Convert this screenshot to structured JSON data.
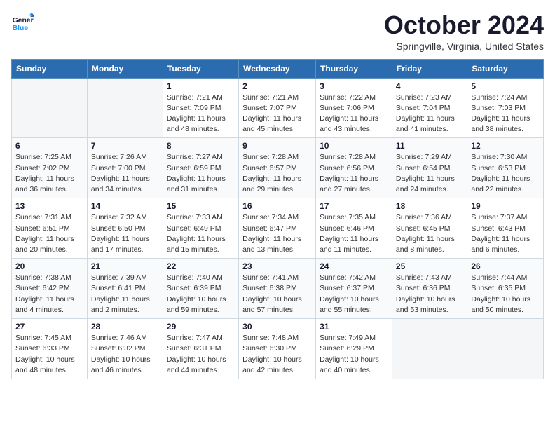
{
  "logo": {
    "text_general": "General",
    "text_blue": "Blue"
  },
  "title": "October 2024",
  "location": "Springville, Virginia, United States",
  "days_of_week": [
    "Sunday",
    "Monday",
    "Tuesday",
    "Wednesday",
    "Thursday",
    "Friday",
    "Saturday"
  ],
  "weeks": [
    [
      {
        "num": "",
        "empty": true
      },
      {
        "num": "",
        "empty": true
      },
      {
        "num": "1",
        "sunrise": "7:21 AM",
        "sunset": "7:09 PM",
        "daylight": "11 hours and 48 minutes."
      },
      {
        "num": "2",
        "sunrise": "7:21 AM",
        "sunset": "7:07 PM",
        "daylight": "11 hours and 45 minutes."
      },
      {
        "num": "3",
        "sunrise": "7:22 AM",
        "sunset": "7:06 PM",
        "daylight": "11 hours and 43 minutes."
      },
      {
        "num": "4",
        "sunrise": "7:23 AM",
        "sunset": "7:04 PM",
        "daylight": "11 hours and 41 minutes."
      },
      {
        "num": "5",
        "sunrise": "7:24 AM",
        "sunset": "7:03 PM",
        "daylight": "11 hours and 38 minutes."
      }
    ],
    [
      {
        "num": "6",
        "sunrise": "7:25 AM",
        "sunset": "7:02 PM",
        "daylight": "11 hours and 36 minutes."
      },
      {
        "num": "7",
        "sunrise": "7:26 AM",
        "sunset": "7:00 PM",
        "daylight": "11 hours and 34 minutes."
      },
      {
        "num": "8",
        "sunrise": "7:27 AM",
        "sunset": "6:59 PM",
        "daylight": "11 hours and 31 minutes."
      },
      {
        "num": "9",
        "sunrise": "7:28 AM",
        "sunset": "6:57 PM",
        "daylight": "11 hours and 29 minutes."
      },
      {
        "num": "10",
        "sunrise": "7:28 AM",
        "sunset": "6:56 PM",
        "daylight": "11 hours and 27 minutes."
      },
      {
        "num": "11",
        "sunrise": "7:29 AM",
        "sunset": "6:54 PM",
        "daylight": "11 hours and 24 minutes."
      },
      {
        "num": "12",
        "sunrise": "7:30 AM",
        "sunset": "6:53 PM",
        "daylight": "11 hours and 22 minutes."
      }
    ],
    [
      {
        "num": "13",
        "sunrise": "7:31 AM",
        "sunset": "6:51 PM",
        "daylight": "11 hours and 20 minutes."
      },
      {
        "num": "14",
        "sunrise": "7:32 AM",
        "sunset": "6:50 PM",
        "daylight": "11 hours and 17 minutes."
      },
      {
        "num": "15",
        "sunrise": "7:33 AM",
        "sunset": "6:49 PM",
        "daylight": "11 hours and 15 minutes."
      },
      {
        "num": "16",
        "sunrise": "7:34 AM",
        "sunset": "6:47 PM",
        "daylight": "11 hours and 13 minutes."
      },
      {
        "num": "17",
        "sunrise": "7:35 AM",
        "sunset": "6:46 PM",
        "daylight": "11 hours and 11 minutes."
      },
      {
        "num": "18",
        "sunrise": "7:36 AM",
        "sunset": "6:45 PM",
        "daylight": "11 hours and 8 minutes."
      },
      {
        "num": "19",
        "sunrise": "7:37 AM",
        "sunset": "6:43 PM",
        "daylight": "11 hours and 6 minutes."
      }
    ],
    [
      {
        "num": "20",
        "sunrise": "7:38 AM",
        "sunset": "6:42 PM",
        "daylight": "11 hours and 4 minutes."
      },
      {
        "num": "21",
        "sunrise": "7:39 AM",
        "sunset": "6:41 PM",
        "daylight": "11 hours and 2 minutes."
      },
      {
        "num": "22",
        "sunrise": "7:40 AM",
        "sunset": "6:39 PM",
        "daylight": "10 hours and 59 minutes."
      },
      {
        "num": "23",
        "sunrise": "7:41 AM",
        "sunset": "6:38 PM",
        "daylight": "10 hours and 57 minutes."
      },
      {
        "num": "24",
        "sunrise": "7:42 AM",
        "sunset": "6:37 PM",
        "daylight": "10 hours and 55 minutes."
      },
      {
        "num": "25",
        "sunrise": "7:43 AM",
        "sunset": "6:36 PM",
        "daylight": "10 hours and 53 minutes."
      },
      {
        "num": "26",
        "sunrise": "7:44 AM",
        "sunset": "6:35 PM",
        "daylight": "10 hours and 50 minutes."
      }
    ],
    [
      {
        "num": "27",
        "sunrise": "7:45 AM",
        "sunset": "6:33 PM",
        "daylight": "10 hours and 48 minutes."
      },
      {
        "num": "28",
        "sunrise": "7:46 AM",
        "sunset": "6:32 PM",
        "daylight": "10 hours and 46 minutes."
      },
      {
        "num": "29",
        "sunrise": "7:47 AM",
        "sunset": "6:31 PM",
        "daylight": "10 hours and 44 minutes."
      },
      {
        "num": "30",
        "sunrise": "7:48 AM",
        "sunset": "6:30 PM",
        "daylight": "10 hours and 42 minutes."
      },
      {
        "num": "31",
        "sunrise": "7:49 AM",
        "sunset": "6:29 PM",
        "daylight": "10 hours and 40 minutes."
      },
      {
        "num": "",
        "empty": true
      },
      {
        "num": "",
        "empty": true
      }
    ]
  ],
  "labels": {
    "sunrise_prefix": "Sunrise: ",
    "sunset_prefix": "Sunset: ",
    "daylight_prefix": "Daylight: "
  }
}
